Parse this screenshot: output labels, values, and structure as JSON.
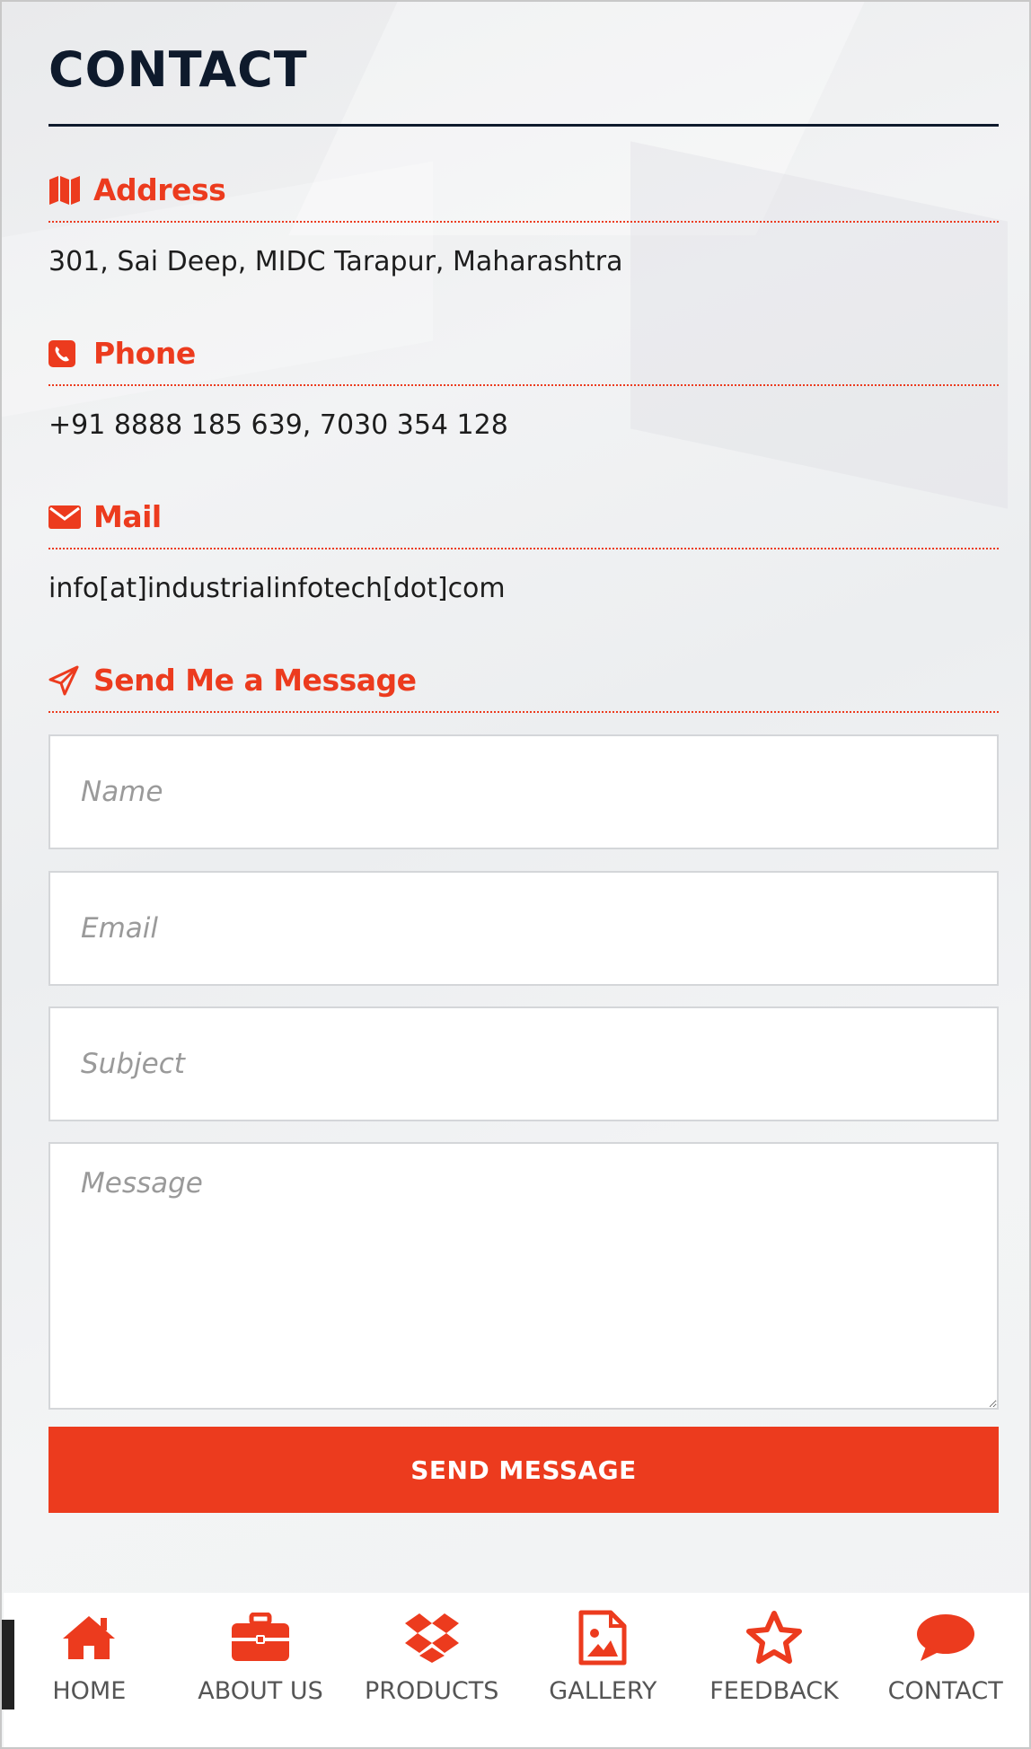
{
  "page": {
    "title": "CONTACT"
  },
  "address": {
    "heading": "Address",
    "icon": "map-icon",
    "text": "301, Sai Deep, MIDC Tarapur, Maharashtra"
  },
  "phone": {
    "heading": "Phone",
    "icon": "phone-icon",
    "text": "+91 8888 185 639, 7030 354 128"
  },
  "mail": {
    "heading": "Mail",
    "icon": "envelope-icon",
    "text": "info[at]industrialinfotech[dot]com"
  },
  "form": {
    "heading": "Send Me a Message",
    "icon": "paper-plane-icon",
    "name_placeholder": "Name",
    "email_placeholder": "Email",
    "subject_placeholder": "Subject",
    "message_placeholder": "Message",
    "submit_label": "SEND MESSAGE"
  },
  "nav": {
    "items": [
      {
        "label": "HOME",
        "icon": "home-icon"
      },
      {
        "label": "ABOUT US",
        "icon": "briefcase-icon"
      },
      {
        "label": "PRODUCTS",
        "icon": "dropbox-icon"
      },
      {
        "label": "GALLERY",
        "icon": "image-file-icon"
      },
      {
        "label": "FEEDBACK",
        "icon": "star-icon"
      },
      {
        "label": "CONTACT",
        "icon": "chat-bubble-icon"
      }
    ]
  },
  "colors": {
    "accent": "#ec3b1e",
    "title": "#0e1a2c",
    "text": "#1d1d1d"
  }
}
